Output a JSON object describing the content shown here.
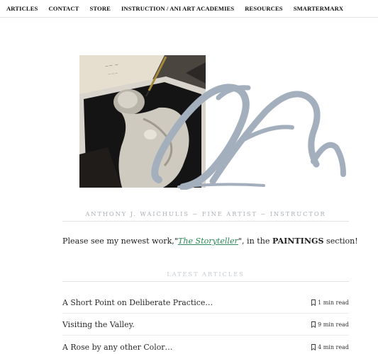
{
  "nav": {
    "items": [
      {
        "label": "ARTICLES"
      },
      {
        "label": "CONTACT"
      },
      {
        "label": "STORE"
      },
      {
        "label": "INSTRUCTION / ANI ART ACADEMIES"
      },
      {
        "label": "RESOURCES"
      },
      {
        "label": "SMARTERMARX"
      }
    ]
  },
  "hero": {
    "photo_icon": "photograph-with-pen",
    "signature_icon": "signature-mark",
    "signature_color": "#a3afbd"
  },
  "tagline": "ANTHONY J. WAICHULIS ~ FINE ARTIST ~ INSTRUCTOR",
  "notice": {
    "prefix": "Please see my newest work,\"",
    "work_title": "The Storyteller",
    "middle": "\", in the ",
    "section": "PAINTINGS",
    "suffix": " section!"
  },
  "latest_heading": "LATEST ARTICLES",
  "articles": [
    {
      "title": "A Short Point on Deliberate Practice…",
      "read_time": "1 min read",
      "icon": "bookmark-icon"
    },
    {
      "title": "Visiting the Valley.",
      "read_time": "9 min read",
      "icon": "bookmark-icon"
    },
    {
      "title": "A Rose by any other Color…",
      "read_time": "4 min read",
      "icon": "bookmark-icon"
    }
  ],
  "colors": {
    "accent_link": "#2a8a57",
    "tagline": "#a9b0b7",
    "signature": "#a3afbd"
  }
}
